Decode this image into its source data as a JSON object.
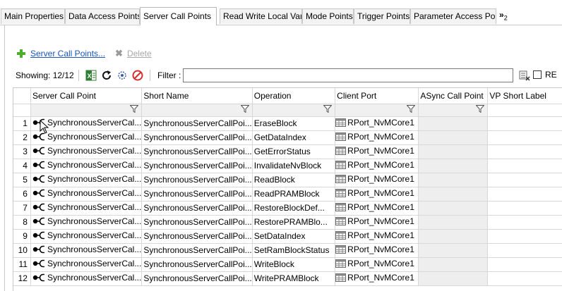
{
  "tabs": [
    {
      "label": "Main Properties",
      "active": false
    },
    {
      "label": "Data Access Points",
      "active": false
    },
    {
      "label": "Server Call Points",
      "active": true
    },
    {
      "label": "Read Write Local Var",
      "active": false
    },
    {
      "label": "Mode Points",
      "active": false
    },
    {
      "label": "Trigger Points",
      "active": false
    },
    {
      "label": "Parameter Access Poi",
      "active": false
    }
  ],
  "tab_overflow": {
    "glyph": "»",
    "count": "2"
  },
  "toolbar": {
    "add_label": "Server Call Points...",
    "delete_label": "Delete",
    "showing_label": "Showing: 12/12",
    "filter_label": "Filter :",
    "filter_value": "",
    "regex_label": "RE"
  },
  "table": {
    "columns": [
      "Server Call Point",
      "Short Name",
      "Operation",
      "Client Port",
      "ASync Call Point",
      "VP Short Label"
    ],
    "rows": [
      {
        "num": "1",
        "scp": "SynchronousServerCal...",
        "short": "SynchronousServerCallPoi...",
        "op": "EraseBlock",
        "port": "RPort_NvMCore1",
        "async": "",
        "vp": ""
      },
      {
        "num": "2",
        "scp": "SynchronousServerCal...",
        "short": "SynchronousServerCallPoi...",
        "op": "GetDataIndex",
        "port": "RPort_NvMCore1",
        "async": "",
        "vp": ""
      },
      {
        "num": "3",
        "scp": "SynchronousServerCal...",
        "short": "SynchronousServerCallPoi...",
        "op": "GetErrorStatus",
        "port": "RPort_NvMCore1",
        "async": "",
        "vp": ""
      },
      {
        "num": "4",
        "scp": "SynchronousServerCal...",
        "short": "SynchronousServerCallPoi...",
        "op": "InvalidateNvBlock",
        "port": "RPort_NvMCore1",
        "async": "",
        "vp": ""
      },
      {
        "num": "5",
        "scp": "SynchronousServerCal...",
        "short": "SynchronousServerCallPoi...",
        "op": "ReadBlock",
        "port": "RPort_NvMCore1",
        "async": "",
        "vp": ""
      },
      {
        "num": "6",
        "scp": "SynchronousServerCal...",
        "short": "SynchronousServerCallPoi...",
        "op": "ReadPRAMBlock",
        "port": "RPort_NvMCore1",
        "async": "",
        "vp": ""
      },
      {
        "num": "7",
        "scp": "SynchronousServerCal...",
        "short": "SynchronousServerCallPoi...",
        "op": "RestoreBlockDef...",
        "port": "RPort_NvMCore1",
        "async": "",
        "vp": ""
      },
      {
        "num": "8",
        "scp": "SynchronousServerCal...",
        "short": "SynchronousServerCallPoi...",
        "op": "RestorePRAMBlo...",
        "port": "RPort_NvMCore1",
        "async": "",
        "vp": ""
      },
      {
        "num": "9",
        "scp": "SynchronousServerCal...",
        "short": "SynchronousServerCallPoi...",
        "op": "SetDataIndex",
        "port": "RPort_NvMCore1",
        "async": "",
        "vp": ""
      },
      {
        "num": "10",
        "scp": "SynchronousServerCal...",
        "short": "SynchronousServerCallPoi...",
        "op": "SetRamBlockStatus",
        "port": "RPort_NvMCore1",
        "async": "",
        "vp": ""
      },
      {
        "num": "11",
        "scp": "SynchronousServerCal...",
        "short": "SynchronousServerCallPoi...",
        "op": "WriteBlock",
        "port": "RPort_NvMCore1",
        "async": "",
        "vp": ""
      },
      {
        "num": "12",
        "scp": "SynchronousServerCal...",
        "short": "SynchronousServerCallPoi...",
        "op": "WritePRAMBlock",
        "port": "RPort_NvMCore1",
        "async": "",
        "vp": ""
      }
    ]
  },
  "colors": {
    "link": "#1a55b8",
    "add_icon": "#4caf2a",
    "delete_disabled": "#a8a8a8",
    "async_col_bg": "#eeeeee"
  },
  "icons": [
    "plus-icon",
    "delete-x-icon",
    "excel-export-icon",
    "refresh-icon",
    "filter-config-icon",
    "no-entry-icon",
    "clear-filter-icon",
    "filter-funnel-icon",
    "connector-icon",
    "table-icon",
    "mouse-cursor-icon"
  ]
}
